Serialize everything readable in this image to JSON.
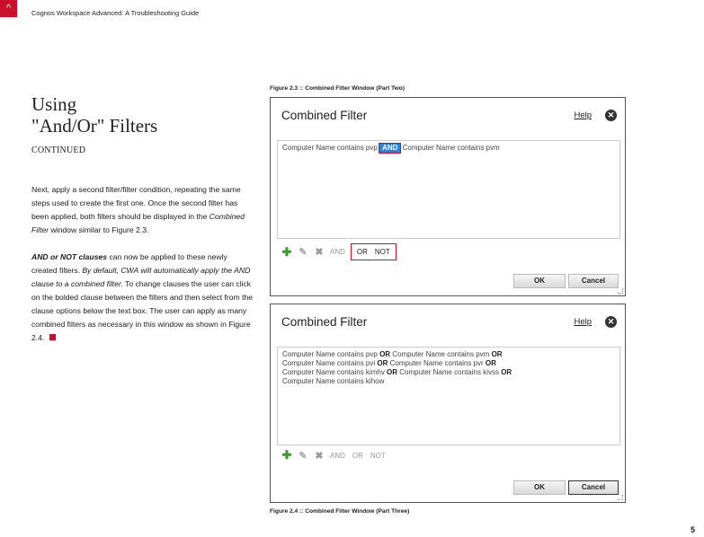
{
  "header": {
    "logo_glyph": "^",
    "title": "Cognos Workspace Advanced: A Troubleshooting Guide"
  },
  "section": {
    "title_line1": "Using",
    "title_line2": "\"And/Or\" Filters",
    "continued": "CONTINUED"
  },
  "body": {
    "para1_a": "Next, apply a second filter/filter condition, repeating the same steps used to create the first one.  Once the second filter has been applied, both filters should be displayed in the ",
    "para1_italic": "Combined Filter",
    "para1_b": " window similar to Figure 2.3.",
    "para2_bold_italic": "AND or NOT clauses",
    "para2_a": " can now be applied to these newly created filters.  ",
    "para2_italic": "By default, CWA will automatically apply the AND clause to a combined filter.",
    "para2_b": "  To change clauses the user can click on the bolded clause between the filters and then select from the clause options below the text box. The user can apply as many combined filters as necessary in this window as shown in Figure 2.4."
  },
  "figures": {
    "top_caption": "Figure 2.3 :: Combined Filter Window (Part Two)",
    "bottom_caption": "Figure 2.4 :: Combined Filter Window (Part Three)"
  },
  "dialog1": {
    "title": "Combined Filter",
    "help": "Help",
    "filter_pre": "Computer Name contains pvp ",
    "filter_op": "AND",
    "filter_post": " Computer Name contains pvm",
    "clause_and": "AND",
    "clause_or": "OR",
    "clause_not": "NOT",
    "ok": "OK",
    "cancel": "Cancel"
  },
  "dialog2": {
    "title": "Combined Filter",
    "help": "Help",
    "lines": [
      {
        "a": "Computer Name contains pvp ",
        "op1": "OR",
        "b": "  Computer Name contains pvm ",
        "op2": "OR"
      },
      {
        "a": "Computer Name contains pvi ",
        "op1": "OR",
        "b": "  Computer Name contains pvr ",
        "op2": "OR"
      },
      {
        "a": "Computer Name contains kimhv ",
        "op1": "OR",
        "b": "  Computer Name contains kivss ",
        "op2": "OR"
      },
      {
        "a": "Computer Name contains kihow",
        "op1": "",
        "b": "",
        "op2": ""
      }
    ],
    "clause_and": "AND",
    "clause_or": "OR",
    "clause_not": "NOT",
    "ok": "OK",
    "cancel": "Cancel"
  },
  "page_number": "5",
  "colors": {
    "accent": "#c8102e",
    "selected_clause": "#2f7fd6"
  }
}
